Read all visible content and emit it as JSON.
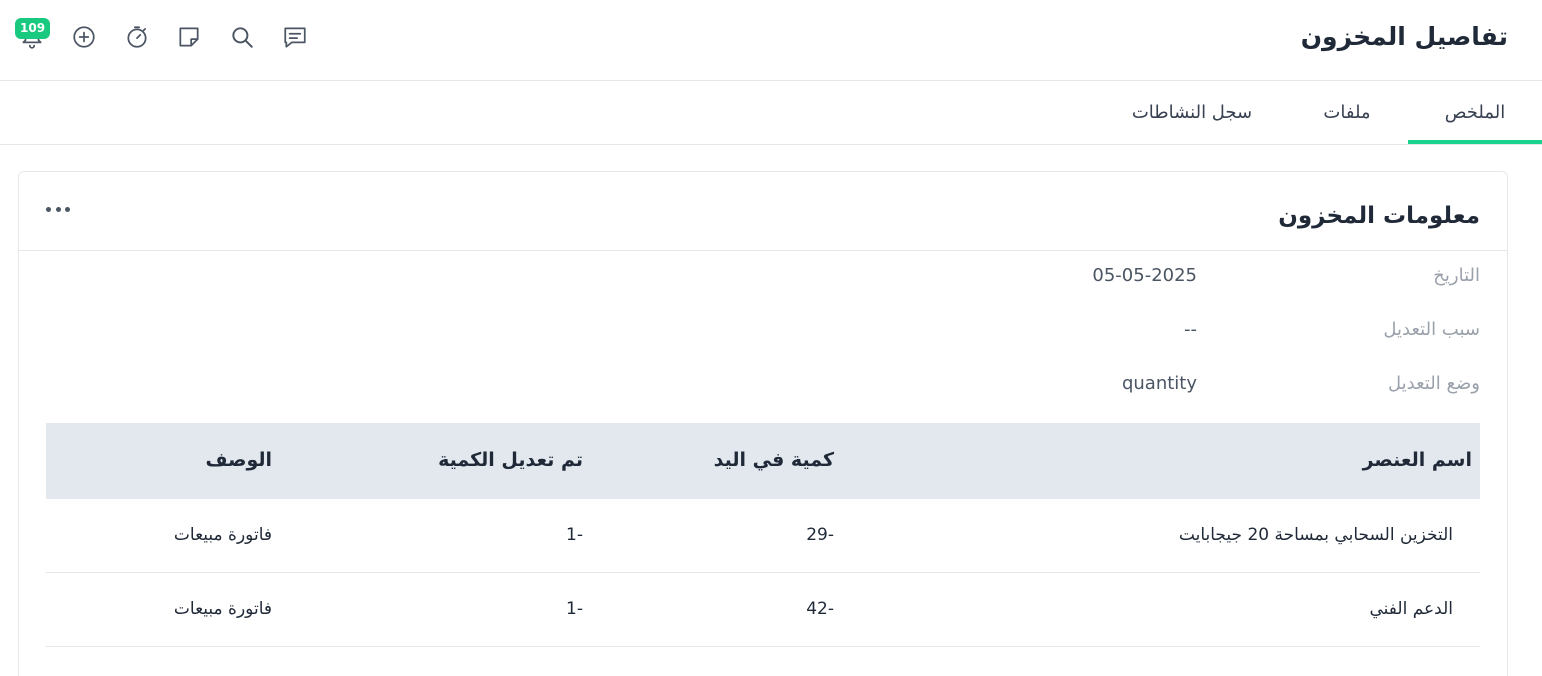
{
  "header": {
    "title": "تفاصيل المخزون",
    "notification_count": "109",
    "icons": [
      "bell-icon",
      "plus-circle-icon",
      "timer-icon",
      "note-icon",
      "search-icon",
      "chat-icon"
    ]
  },
  "tabs": [
    {
      "label": "الملخص",
      "active": true
    },
    {
      "label": "ملفات",
      "active": false
    },
    {
      "label": "سجل النشاطات",
      "active": false
    }
  ],
  "card": {
    "title": "معلومات المخزون",
    "more_icon": "more-dots-icon",
    "info": [
      {
        "label": "التاريخ",
        "value": "05-05-2025"
      },
      {
        "label": "سبب التعديل",
        "value": "--"
      },
      {
        "label": "وضع التعديل",
        "value": "quantity"
      }
    ]
  },
  "table": {
    "columns": [
      "اسم العنصر",
      "كمية في اليد",
      "تم تعديل الكمية",
      "الوصف"
    ],
    "rows": [
      {
        "item": "التخزين السحابي بمساحة 20 جيجابايت",
        "on_hand": "-29",
        "adjusted": "-1",
        "description": "فاتورة مبيعات"
      },
      {
        "item": "الدعم الفني",
        "on_hand": "-42",
        "adjusted": "-1",
        "description": "فاتورة مبيعات"
      }
    ]
  },
  "colors": {
    "accent": "#19d38f",
    "badge": "#19c97f",
    "table_header_bg": "#e3e8ef"
  }
}
